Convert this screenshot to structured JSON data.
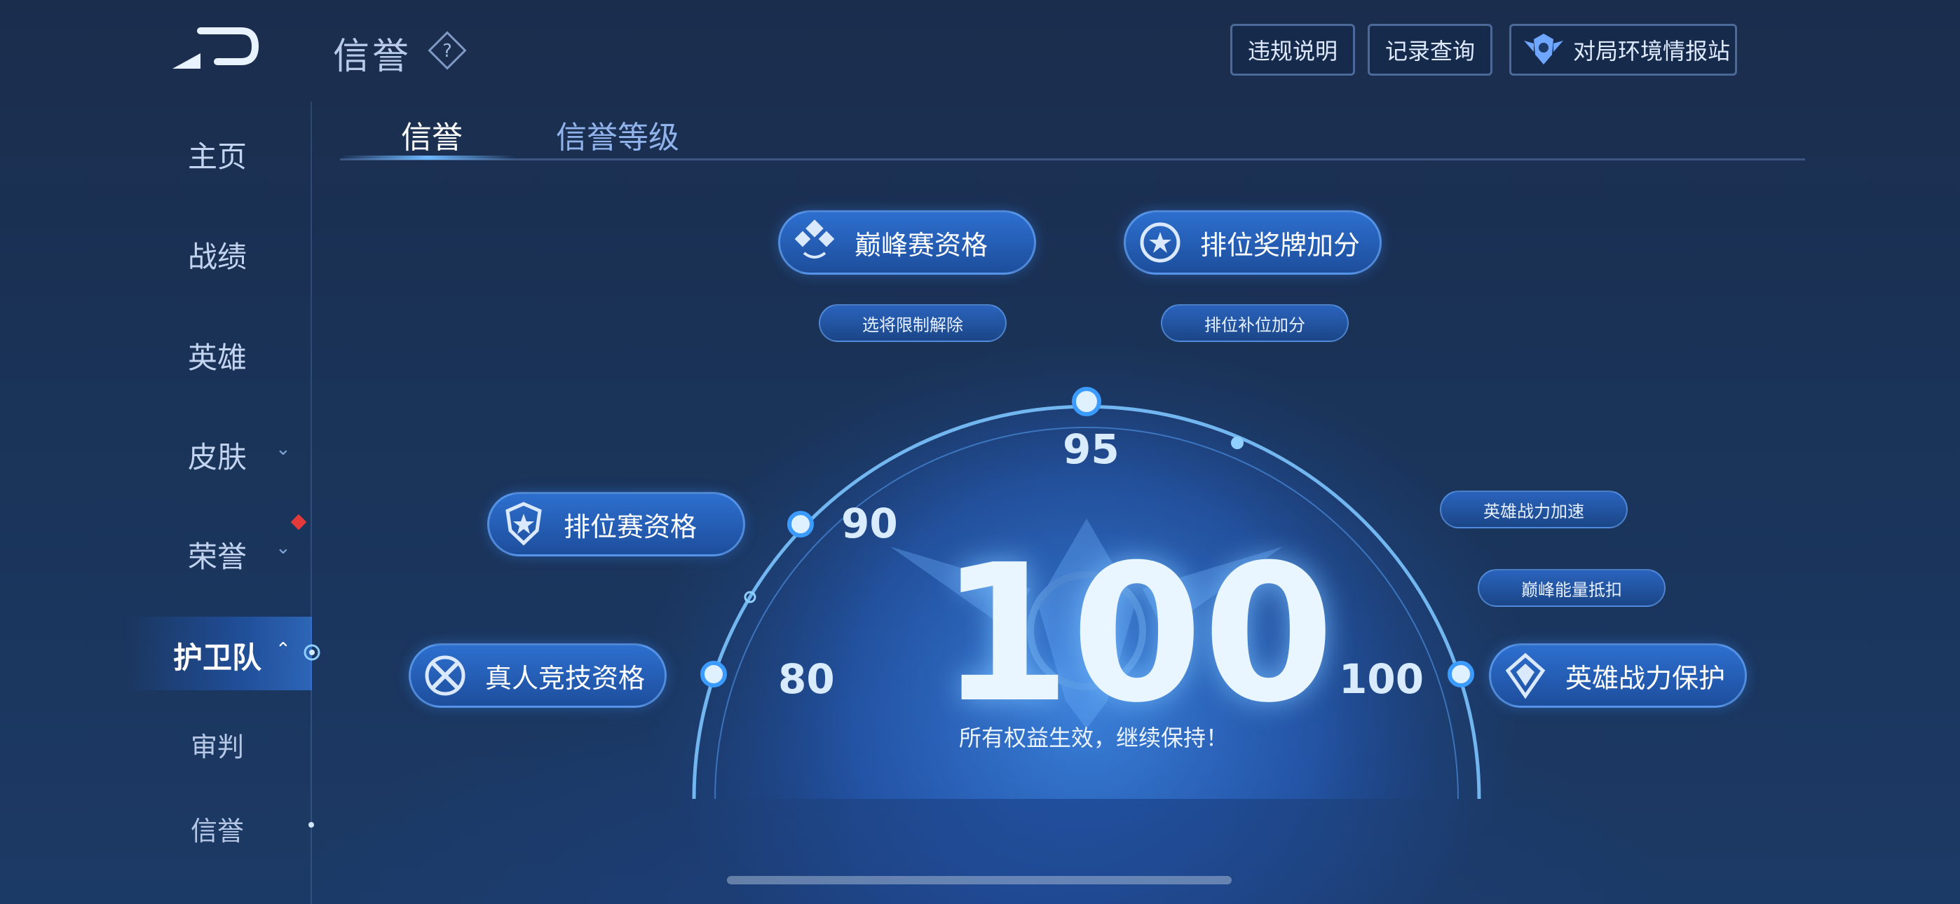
{
  "header": {
    "title": "信誉",
    "buttons": {
      "rules": "违规说明",
      "records": "记录查询",
      "env_report": "对局环境情报站"
    }
  },
  "sidebar": {
    "items": [
      {
        "label": "主页"
      },
      {
        "label": "战绩"
      },
      {
        "label": "英雄"
      },
      {
        "label": "皮肤"
      },
      {
        "label": "荣誉"
      },
      {
        "label": "护卫队"
      }
    ],
    "subitems": [
      {
        "label": "审判"
      },
      {
        "label": "信誉"
      }
    ]
  },
  "tabs": [
    {
      "label": "信誉",
      "active": true
    },
    {
      "label": "信誉等级",
      "active": false
    }
  ],
  "benefits": {
    "peak_qualification": "巅峰赛资格",
    "pick_restriction_lifted": "选将限制解除",
    "ranked_medal_bonus": "排位奖牌加分",
    "ranked_fill_bonus": "排位补位加分",
    "ranked_qualification": "排位赛资格",
    "real_player_qualification": "真人竞技资格",
    "hero_power_speedup": "英雄战力加速",
    "peak_energy_offset": "巅峰能量抵扣",
    "hero_power_protection": "英雄战力保护"
  },
  "gauge": {
    "score": "100",
    "status": "所有权益生效，继续保持！",
    "ticks": {
      "t80": "80",
      "t90": "90",
      "t95": "95",
      "t100": "100"
    }
  },
  "colors": {
    "accent": "#3a8cff",
    "pill": "#2d6fcf",
    "alert": "#e23a3a"
  }
}
